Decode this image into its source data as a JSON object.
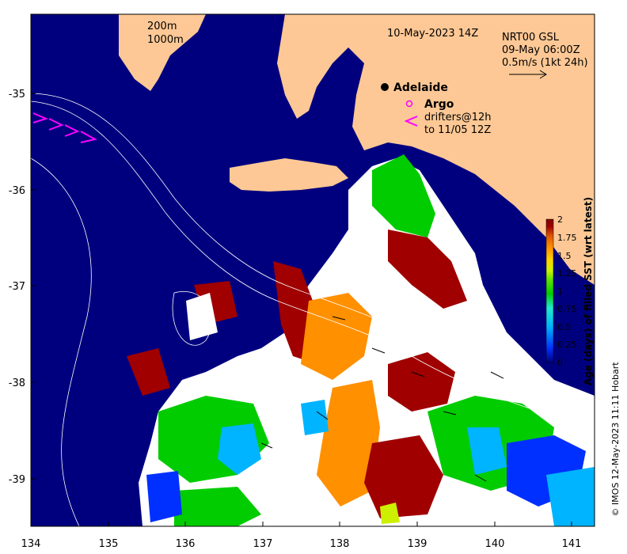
{
  "map": {
    "title_date": "10-May-2023 14Z",
    "product": "NRT00 GSL",
    "product_time": "09-May 06:00Z",
    "velocity_scale": "0.5m/s (1kt 24h)",
    "contour_labels": [
      "200m",
      "1000m"
    ],
    "city": "Adelaide",
    "argo_label": "Argo",
    "drifters_line1": "drifters@12h",
    "drifters_line2": "to 11/05 12Z",
    "credit": "© IMOS 12-May-2023 11:11 Hobart",
    "longitude_ticks": [
      "134",
      "135",
      "136",
      "137",
      "138",
      "139",
      "140",
      "141"
    ],
    "latitude_ticks": [
      "-35",
      "-36",
      "-37",
      "-38",
      "-39"
    ],
    "colorbar": {
      "title": "Age (days) of filled SST (wrt latest)",
      "ticks": [
        "2",
        "1.75",
        "1.5",
        "1.25",
        "1",
        "0.75",
        "0.5",
        "0.25",
        "0"
      ],
      "colors": [
        "#00007f",
        "#0030ff",
        "#00b4ff",
        "#20e8d0",
        "#00cc00",
        "#60e000",
        "#ccf000",
        "#ffd000",
        "#ff9000",
        "#e05a00",
        "#a00000",
        "#800000"
      ]
    },
    "colors": {
      "ocean": "#00007f",
      "land": "#fdc895",
      "gap": "#ffffff",
      "drifter": "#ff00ff"
    }
  }
}
